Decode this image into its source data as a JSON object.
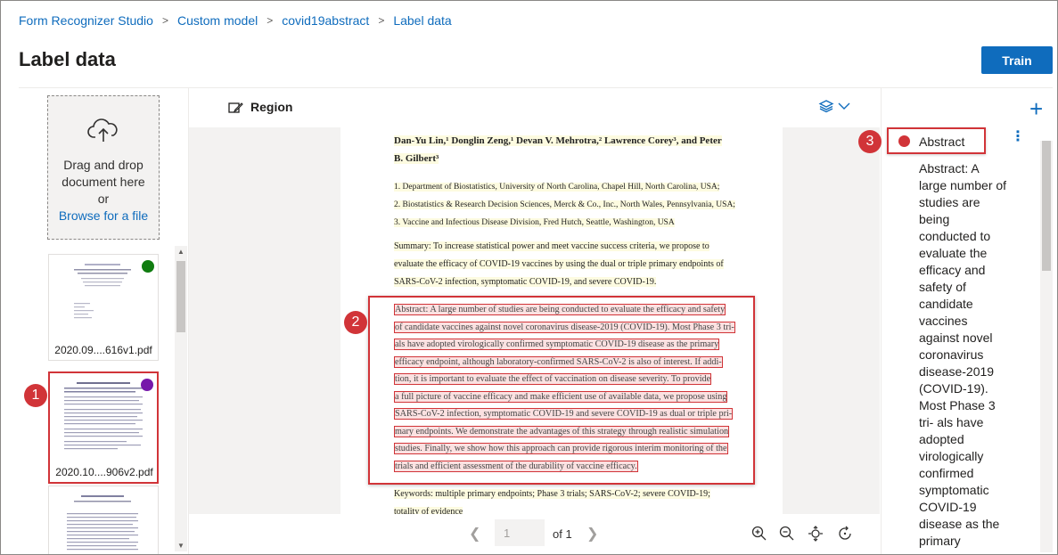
{
  "breadcrumb": {
    "items": [
      "Form Recognizer Studio",
      "Custom model",
      "covid19abstract",
      "Label data"
    ],
    "separator": ">"
  },
  "header": {
    "title": "Label data",
    "train_label": "Train"
  },
  "left_panel": {
    "dropzone": {
      "line1": "Drag and drop",
      "line2": "document here",
      "line3": "or",
      "browse_link": "Browse for a file",
      "icon": "cloud-upload-icon"
    },
    "documents": [
      {
        "name": "2020.09....616v1.pdf",
        "status_color": "#107c10"
      },
      {
        "name": "2020.10....906v2.pdf",
        "status_color": "#7719aa",
        "selected": true
      },
      {
        "name": "",
        "status_color": ""
      }
    ]
  },
  "toolbar": {
    "region_label": "Region",
    "region_icon": "region-draw-icon",
    "layers_icon": "layers-icon"
  },
  "document": {
    "authors_line1": "Dan-Yu Lin,¹ Donglin Zeng,¹ Devan V. Mehrotra,² Lawrence Corey³, and Peter",
    "authors_line2": "B. Gilbert³",
    "affil1": "1. Department of Biostatistics, University of North Carolina, Chapel Hill, North Carolina, USA;",
    "affil2": "2. Biostatistics & Research Decision Sciences, Merck & Co., Inc., North Wales, Pennsylvania, USA;",
    "affil3": "3. Vaccine and Infectious Disease Division, Fred Hutch, Seattle, Washington, USA",
    "summary1": "Summary: To increase statistical power and meet vaccine success criteria, we propose to",
    "summary2": "evaluate the efficacy of COVID-19 vaccines by using the dual or triple primary endpoints of",
    "summary3": "SARS-CoV-2 infection, symptomatic COVID-19, and severe COVID-19.",
    "abstract_lines": [
      "Abstract: A large number of studies are being conducted to evaluate the efficacy and safety",
      "of candidate vaccines against novel coronavirus disease-2019 (COVID-19). Most Phase 3 tri-",
      "als have adopted virologically confirmed symptomatic COVID-19 disease as the primary",
      "efficacy endpoint, although laboratory-confirmed SARS-CoV-2 is also of interest. If addi-",
      "tion, it is important to evaluate the effect of vaccination on disease severity. To provide",
      "a full picture of vaccine efficacy and make efficient use of available data, we propose using",
      "SARS-CoV-2 infection, symptomatic COVID-19 and severe COVID-19 as dual or triple pri-",
      "mary endpoints. We demonstrate the advantages of this strategy through realistic simulation",
      "studies. Finally, we show how this approach can provide rigorous interim monitoring of the",
      "trials and efficient assessment of the durability of vaccine efficacy."
    ],
    "keywords1": "Keywords: multiple primary endpoints; Phase 3 trials; SARS-CoV-2; severe COVID-19;",
    "keywords2": "totality of evidence"
  },
  "pager": {
    "current_page": "1",
    "of_label": "of 1"
  },
  "right_panel": {
    "field": {
      "name": "Abstract",
      "color": "#d13438",
      "value": "Abstract: A large number of studies are being conducted to evaluate the efficacy and safety of candidate vaccines against novel coronavirus disease-2019 (COVID-19). Most Phase 3 tri- als have adopted virologically confirmed symptomatic COVID-19 disease as the primary"
    }
  },
  "callouts": [
    "1",
    "2",
    "3"
  ]
}
